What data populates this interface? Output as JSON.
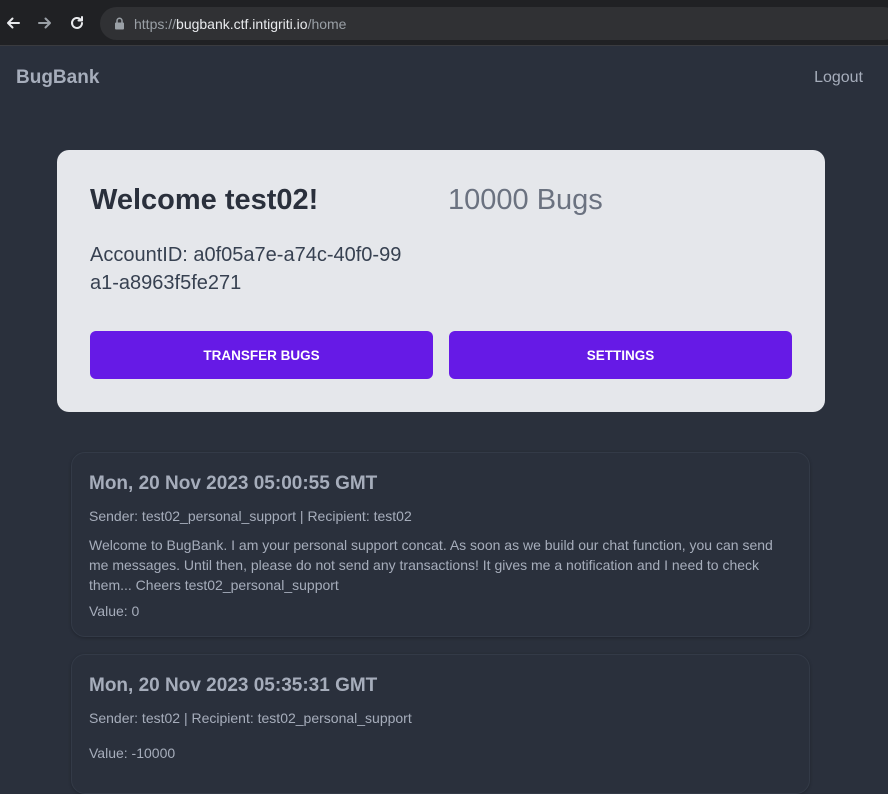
{
  "browser": {
    "url_scheme": "https://",
    "url_host": "bugbank.ctf.intigriti.io",
    "url_path": "/home",
    "icons": {
      "back": "arrow-left-icon",
      "forward": "arrow-right-icon",
      "reload": "reload-icon",
      "lock": "lock-icon"
    }
  },
  "header": {
    "brand": "BugBank",
    "logout_label": "Logout"
  },
  "account": {
    "welcome": "Welcome test02!",
    "balance": "10000 Bugs",
    "account_id": "AccountID: a0f05a7e-a74c-40f0-99a1-a8963f5fe271",
    "transfer_label": "TRANSFER BUGS",
    "settings_label": "SETTINGS"
  },
  "transactions": [
    {
      "date": "Mon, 20 Nov 2023 05:00:55 GMT",
      "parties": "Sender: test02_personal_support | Recipient: test02",
      "message": "Welcome to BugBank. I am your personal support concat. As soon as we build our chat function, you can send me messages. Until then, please do not send any transactions! It gives me a notification and I need to check them... Cheers test02_personal_support",
      "value": "Value: 0"
    },
    {
      "date": "Mon, 20 Nov 2023 05:35:31 GMT",
      "parties": "Sender: test02 | Recipient: test02_personal_support",
      "message": "",
      "value": "Value: -10000"
    }
  ],
  "colors": {
    "background": "#2a303c",
    "card": "#e5e7eb",
    "primary": "#661ae6",
    "text_muted": "#a6adbb"
  }
}
